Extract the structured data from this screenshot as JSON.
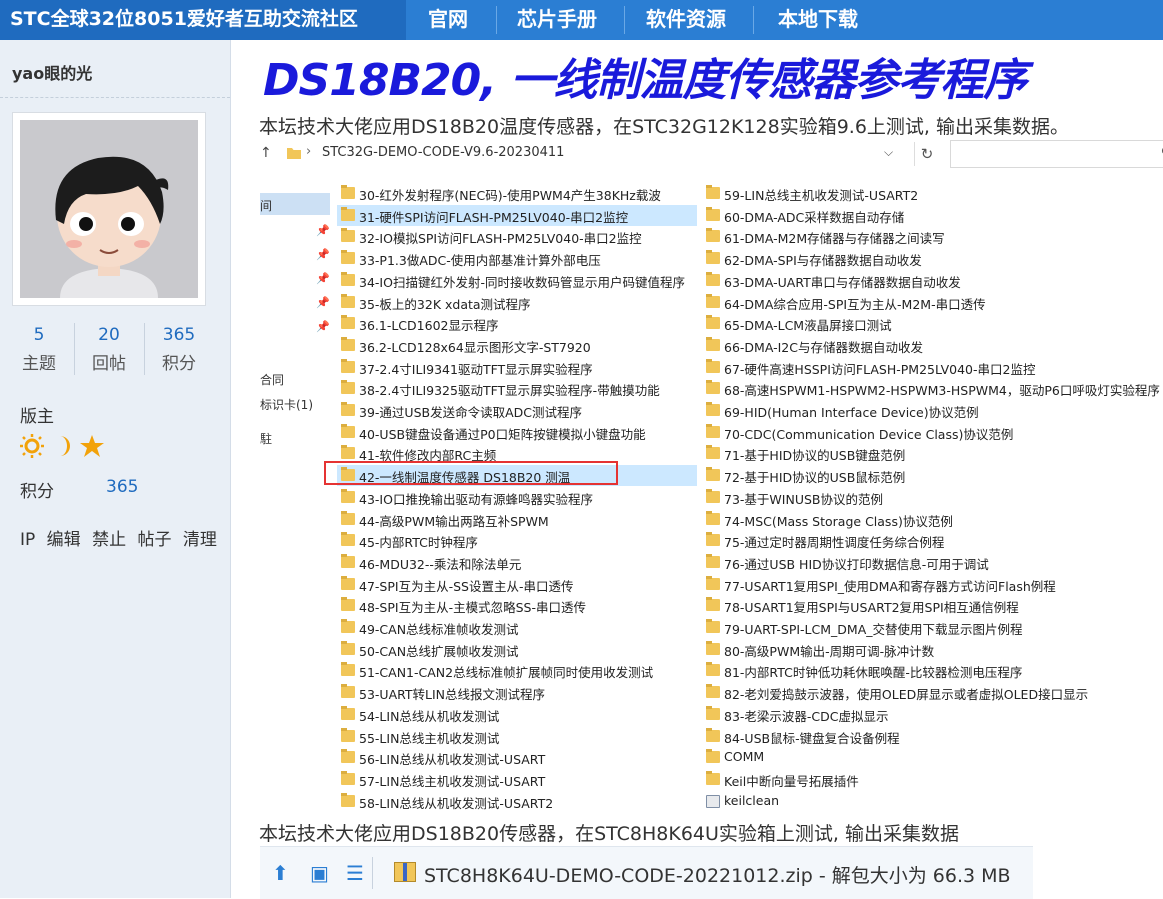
{
  "topnav": {
    "site_name": "STC全球32位8051爱好者互助交流社区",
    "links": [
      "官网",
      "芯片手册",
      "软件资源",
      "本地下载"
    ]
  },
  "user": {
    "name": "yao眼的光",
    "stats": [
      {
        "value": "5",
        "label": "主题"
      },
      {
        "value": "20",
        "label": "回帖"
      },
      {
        "value": "365",
        "label": "积分"
      }
    ],
    "rank": "版主",
    "points_label": "积分",
    "points_value": "365",
    "admin_actions": [
      "IP",
      "编辑",
      "禁止",
      "帖子",
      "清理"
    ]
  },
  "post": {
    "title": "DS18B20, 一线制温度传感器参考程序",
    "desc1": "本坛技术大佬应用DS18B20温度传感器，在STC32G12K128实验箱9.6上测试, 输出采集数据。",
    "desc2": "本坛技术大佬应用DS18B20传感器，在STC8H8K64U实验箱上测试, 输出采集数据"
  },
  "explorer": {
    "path": "STC32G-DEMO-CODE-V9.6-20230411",
    "nav_items": [
      "间",
      "合同",
      "标识卡(1)",
      "駐"
    ],
    "left_column": [
      "30-红外发射程序(NEC码)-使用PWM4产生38KHz载波",
      "31-硬件SPI访问FLASH-PM25LV040-串口2监控",
      "32-IO模拟SPI访问FLASH-PM25LV040-串口2监控",
      "33-P1.3做ADC-使用内部基准计算外部电压",
      "34-IO扫描键红外发射-同时接收数码管显示用户码键值程序",
      "35-板上的32K xdata测试程序",
      "36.1-LCD1602显示程序",
      "36.2-LCD128x64显示图形文字-ST7920",
      "37-2.4寸ILI9341驱动TFT显示屏实验程序",
      "38-2.4寸ILI9325驱动TFT显示屏实验程序-带触摸功能",
      "39-通过USB发送命令读取ADC测试程序",
      "40-USB键盘设备通过P0口矩阵按键模拟小键盘功能",
      "41-软件修改内部RC主频",
      "42-一线制温度传感器 DS18B20 测温",
      "43-IO口推挽输出驱动有源蜂鸣器实验程序",
      "44-高级PWM输出两路互补SPWM",
      "45-内部RTC时钟程序",
      "46-MDU32--乘法和除法单元",
      "47-SPI互为主从-SS设置主从-串口透传",
      "48-SPI互为主从-主模式忽略SS-串口透传",
      "49-CAN总线标准帧收发测试",
      "50-CAN总线扩展帧收发测试",
      "51-CAN1-CAN2总线标准帧扩展帧同时使用收发测试",
      "53-UART转LIN总线报文测试程序",
      "54-LIN总线从机收发测试",
      "55-LIN总线主机收发测试",
      "56-LIN总线从机收发测试-USART",
      "57-LIN总线主机收发测试-USART",
      "58-LIN总线从机收发测试-USART2"
    ],
    "right_column": [
      "59-LIN总线主机收发测试-USART2",
      "60-DMA-ADC采样数据自动存储",
      "61-DMA-M2M存储器与存储器之间读写",
      "62-DMA-SPI与存储器数据自动收发",
      "63-DMA-UART串口与存储器数据自动收发",
      "64-DMA综合应用-SPI互为主从-M2M-串口透传",
      "65-DMA-LCM液晶屏接口测试",
      "66-DMA-I2C与存储器数据自动收发",
      "67-硬件高速HSSPI访问FLASH-PM25LV040-串口2监控",
      "68-高速HSPWM1-HSPWM2-HSPWM3-HSPWM4，驱动P6口呼吸灯实验程序",
      "69-HID(Human Interface Device)协议范例",
      "70-CDC(Communication Device Class)协议范例",
      "71-基于HID协议的USB键盘范例",
      "72-基于HID协议的USB鼠标范例",
      "73-基于WINUSB协议的范例",
      "74-MSC(Mass Storage Class)协议范例",
      "75-通过定时器周期性调度任务综合例程",
      "76-通过USB HID协议打印数据信息-可用于调试",
      "77-USART1复用SPI_使用DMA和寄存器方式访问Flash例程",
      "78-USART1复用SPI与USART2复用SPI相互通信例程",
      "79-UART-SPI-LCM_DMA_交替使用下载显示图片例程",
      "80-高级PWM输出-周期可调-脉冲计数",
      "81-内部RTC时钟低功耗休眠唤醒-比较器检测电压程序",
      "82-老刘爱捣鼓示波器，使用OLED屏显示或者虚拟OLED接口显示",
      "83-老梁示波器-CDC虚拟显示",
      "84-USB鼠标-键盘复合设备例程",
      "COMM",
      "Keil中断向量号拓展插件",
      "keilclean"
    ]
  },
  "download": {
    "filename": "STC8H8K64U-DEMO-CODE-20221012.zip - 解包大小为 66.3 MB"
  },
  "colors": {
    "nav_bg": "#2b7ed3",
    "title": "#1a1adb",
    "highlight_box": "#e53333",
    "folder": "#f1c659"
  }
}
